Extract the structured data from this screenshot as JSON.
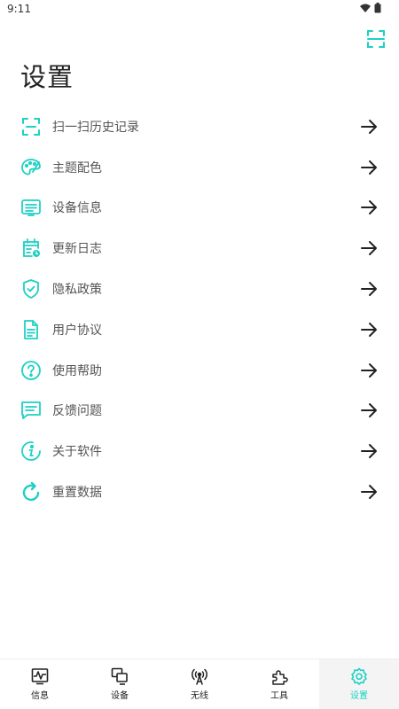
{
  "colors": {
    "accent": "#1dd1c4",
    "text": "#222222",
    "label": "#555555"
  },
  "status_bar": {
    "time": "9:11"
  },
  "header": {
    "title": "设置",
    "scan_icon": "scan-icon"
  },
  "menu": {
    "items": [
      {
        "label": "扫一扫历史记录",
        "icon": "scan-history-icon"
      },
      {
        "label": "主题配色",
        "icon": "palette-icon"
      },
      {
        "label": "设备信息",
        "icon": "device-info-icon"
      },
      {
        "label": "更新日志",
        "icon": "calendar-log-icon"
      },
      {
        "label": "隐私政策",
        "icon": "shield-check-icon"
      },
      {
        "label": "用户协议",
        "icon": "document-icon"
      },
      {
        "label": "使用帮助",
        "icon": "help-icon"
      },
      {
        "label": "反馈问题",
        "icon": "feedback-icon"
      },
      {
        "label": "关于软件",
        "icon": "info-icon"
      },
      {
        "label": "重置数据",
        "icon": "refresh-icon"
      }
    ]
  },
  "bottom_nav": {
    "active": "设置",
    "items": [
      {
        "label": "信息",
        "icon": "activity-icon"
      },
      {
        "label": "设备",
        "icon": "devices-icon"
      },
      {
        "label": "无线",
        "icon": "antenna-icon"
      },
      {
        "label": "工具",
        "icon": "puzzle-icon"
      },
      {
        "label": "设置",
        "icon": "settings-icon"
      }
    ]
  }
}
